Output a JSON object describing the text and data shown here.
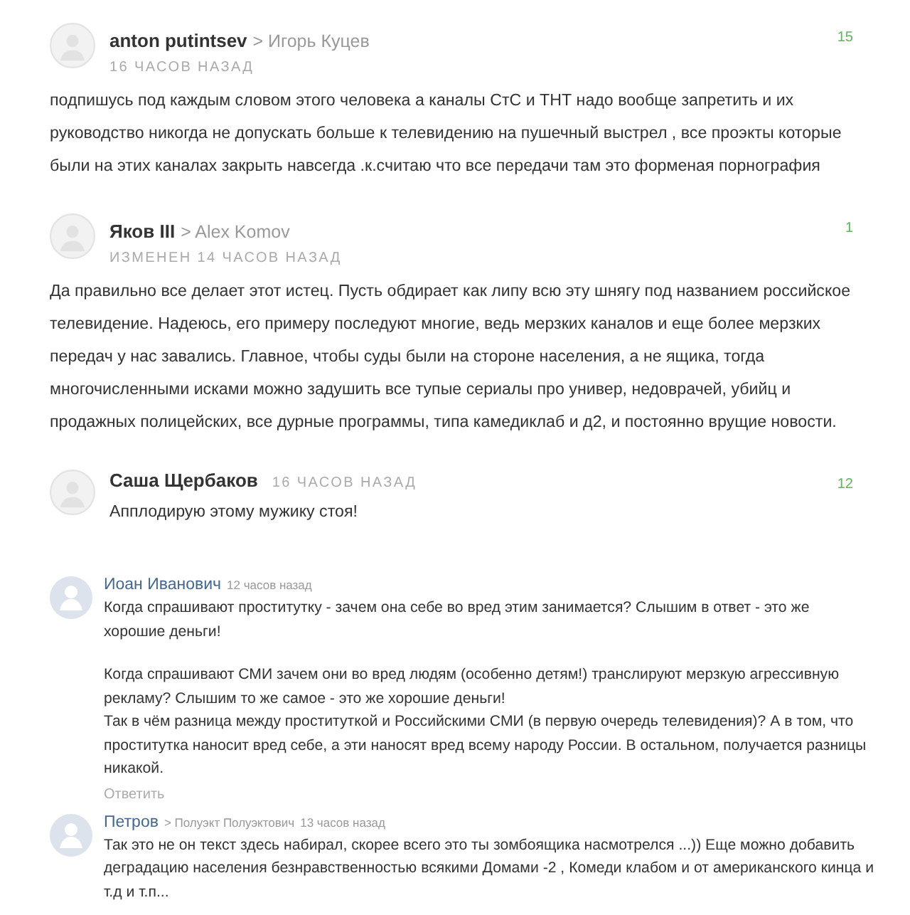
{
  "comments": [
    {
      "kind": "card",
      "author": "anton putintsev",
      "reply_to": "> Игорь Куцев",
      "time": "16 ЧАСОВ НАЗАД",
      "score": "15",
      "paragraphs": [
        "подпишусь под каждым словом этого человека а каналы СтС и ТНТ надо вообще запретить и их руководство никогда не допускать больше к телевидению на пушечный выстрел , все проэкты которые были на этих каналах закрыть навсегда .к.считаю что все передачи там это форменая порнография"
      ]
    },
    {
      "kind": "card",
      "author": "Яков III",
      "reply_to": "> Alex Komov",
      "time": "ИЗМЕНЕН 14 ЧАСОВ НАЗАД",
      "score": "1",
      "paragraphs": [
        "Да правильно все делает этот истец. Пусть обдирает как липу всю эту шнягу под названием российское телевидение. Надеюсь, его примеру последуют многие, ведь мерзких каналов и еще более мерзких передач у нас завались. Главное, чтобы суды были на стороне населения, а не ящика, тогда многочисленными исками можно задушить все тупые сериалы про универ, недоврачей, убийц и продажных полицейских, все дурные программы, типа камедиклаб и д2, и постоянно врущие новости."
      ]
    },
    {
      "kind": "inline",
      "author": "Саша Щербаков",
      "time": "16 ЧАСОВ НАЗАД",
      "score": "12",
      "paragraphs": [
        "Апплодирую этому мужику стоя!"
      ]
    },
    {
      "kind": "vk",
      "author": "Иоан Иванович",
      "time": "12 часов назад",
      "paragraphs": [
        "Когда спрашивают проститутку - зачем она себе во вред этим занимается? Слышим в ответ - это же хорошие деньги!",
        "Когда спрашивают СМИ зачем они во вред людям (особенно детям!) транслируют мерзкую агрессивную рекламу? Слышим то же самое - это же хорошие деньги!\nТак в чём разница между проституткой и Российскими СМИ (в первую очередь телевидения)? А в том, что проститутка наносит вред себе, а эти наносят вред всему народу России. В остальном, получается разницы никакой."
      ],
      "reply_link": "Ответить"
    },
    {
      "kind": "vk",
      "author": "Петров",
      "reply_to": "> Полуэкт Полуэктович",
      "time": "13 часов назад",
      "paragraphs": [
        "Так это не он текст здесь набирал, скорее всего это ты зомбоящика насмотрелся ...)) Еще можно добавить деградацию населения безнравственностью всякими Домами -2 , Комеди клабом и от американского кинца и т.д и т.п..."
      ]
    }
  ]
}
